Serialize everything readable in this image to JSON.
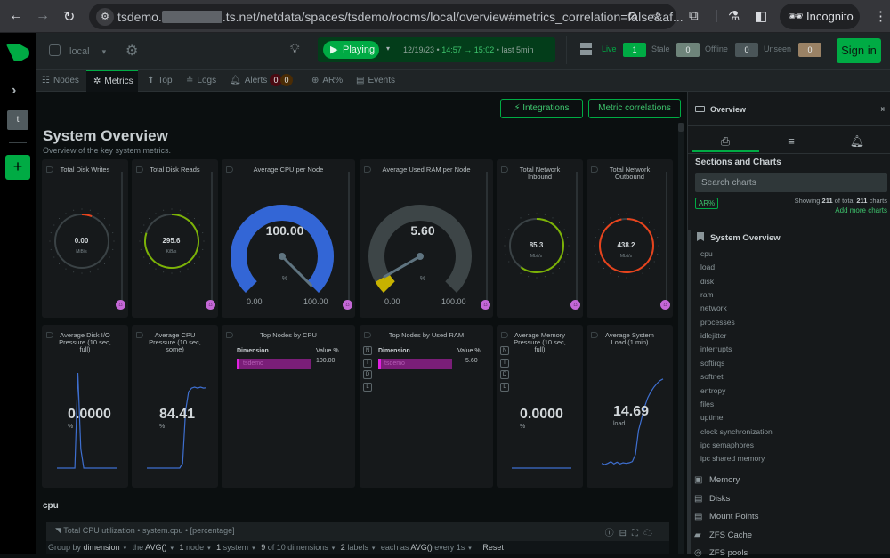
{
  "browser": {
    "url_prefix": "tsdemo.",
    "url_suffix": ".ts.net/netdata/spaces/tsdemo/rooms/local/overview#metrics_correlation=false&af...",
    "incognito_label": "Incognito",
    "icons": [
      "back-icon",
      "forward-icon",
      "reload-icon",
      "site-info-icon",
      "eye-off-icon",
      "star-icon",
      "extensions-icon",
      "labs-icon",
      "sidepanel-icon",
      "incognito-icon",
      "kebab-menu-icon"
    ]
  },
  "rail": {
    "space_initial": "t",
    "add_label": "+"
  },
  "topbar": {
    "room": "local",
    "play_label": "Playing",
    "date": "12/19/23",
    "time_from": "14:57",
    "arrow": "→",
    "time_to": "15:02",
    "last": "last  5min",
    "status": [
      {
        "label": "Live",
        "count": "1",
        "color": "#00ab44",
        "label_color": "#00ab44"
      },
      {
        "label": "Stale",
        "count": "0",
        "color": "#6e847a",
        "label_color": "#6c777b"
      },
      {
        "label": "Offline",
        "count": "0",
        "color": "#4a5558",
        "label_color": "#6c777b"
      },
      {
        "label": "Unseen",
        "count": "0",
        "color": "#9a8265",
        "label_color": "#6c777b"
      }
    ],
    "signin_label": "Sign in"
  },
  "tabs": [
    {
      "label": "Nodes",
      "icon": "☷"
    },
    {
      "label": "Metrics",
      "icon": "✲"
    },
    {
      "label": "Top",
      "icon": "⬆"
    },
    {
      "label": "Logs",
      "icon": "≗"
    },
    {
      "label": "Alerts",
      "icon": "🔔︎",
      "badges": [
        "0",
        "0"
      ]
    },
    {
      "label": "AR%",
      "icon": "⊕"
    },
    {
      "label": "Events",
      "icon": "▤"
    }
  ],
  "main": {
    "integrations_label": "Integrations",
    "metric_corr_label": "Metric correlations",
    "title": "System Overview",
    "subtitle": "Overview of the key system metrics.",
    "cards_row1": [
      {
        "title": "Total Disk Writes",
        "value": "0.00",
        "unit": "MiB/s",
        "fraction": 0.06,
        "color": "#e8431c",
        "start": 0.0
      },
      {
        "title": "Total Disk Reads",
        "value": "295.6",
        "unit": "KiB/s",
        "fraction": 0.8,
        "color": "#7cb305",
        "start": 0.0
      },
      {
        "title": "Average CPU per Node",
        "value": "100.00",
        "unit": "%",
        "min": "0.00",
        "max": "100.00",
        "fraction": 1.0,
        "color": "#3366d6"
      },
      {
        "title": "Average Used RAM per Node",
        "value": "5.60",
        "unit": "%",
        "min": "0.00",
        "max": "100.00",
        "fraction": 0.056,
        "color": "#c7b200"
      },
      {
        "title": "Total Network Inbound",
        "value": "85.3",
        "unit": "Mbit/s",
        "fraction": 0.6,
        "color": "#7cb305",
        "start": 0.0
      },
      {
        "title": "Total Network Outbound",
        "value": "438.2",
        "unit": "Mbit/s",
        "fraction": 0.97,
        "color": "#e8431c",
        "start": 0.0
      }
    ],
    "cards_row2": [
      {
        "title": "Average Disk I/O Pressure (10 sec, full)",
        "value": "0.0000",
        "unit": "%"
      },
      {
        "title": "Average CPU Pressure (10 sec, some)",
        "value": "84.41",
        "unit": "%"
      },
      {
        "title": "Top Nodes by CPU",
        "dim_header": "Dimension",
        "val_header": "Value %",
        "rows": [
          {
            "name": "tsdemo",
            "value": "100.00"
          }
        ]
      },
      {
        "title": "Top Nodes by Used RAM",
        "dim_header": "Dimension",
        "val_header": "Value %",
        "rows": [
          {
            "name": "tsdemo",
            "value": "5.60"
          }
        ],
        "ndil": [
          "N",
          "I",
          "D",
          "L"
        ]
      },
      {
        "title": "Average Memory Pressure (10 sec, full)",
        "value": "0.0000",
        "unit": "%",
        "ndil": [
          "N",
          "I",
          "D",
          "L"
        ]
      },
      {
        "title": "Average System Load (1 min)",
        "value": "14.69",
        "unit": "load"
      }
    ],
    "section": "cpu",
    "cpu_chart": {
      "title": "Total CPU utilization • system.cpu • [percentage]",
      "group_by": "Group by",
      "group_by_val": "dimension",
      "the": "the",
      "agg": "AVG()",
      "nodes_n": "1",
      "nodes": "node",
      "systems_n": "1",
      "systems": "system",
      "dims_n": "9",
      "dims": "of 10 dimensions",
      "labels_n": "2",
      "labels": "labels",
      "each_as": "each as",
      "each_agg": "AVG()",
      "every": "every 1s",
      "reset": "Reset"
    }
  },
  "chart_data": [
    {
      "type": "line",
      "title": "Average Disk I/O Pressure (10 sec, full)",
      "x": [
        0,
        1,
        2,
        3,
        4,
        5,
        6,
        7,
        8,
        9,
        10,
        11,
        12,
        13,
        14,
        15,
        16,
        17,
        18,
        19,
        20
      ],
      "values": [
        0,
        0,
        0,
        0,
        0,
        0,
        0,
        100,
        20,
        0,
        0,
        0,
        0,
        0,
        0,
        0,
        0,
        0,
        0,
        0,
        0
      ],
      "ylabel": "%"
    },
    {
      "type": "line",
      "title": "Average CPU Pressure (10 sec, some)",
      "x": [
        0,
        1,
        2,
        3,
        4,
        5,
        6,
        7,
        8,
        9,
        10,
        11,
        12,
        13,
        14,
        15,
        16,
        17,
        18,
        19,
        20
      ],
      "values": [
        0,
        0,
        0,
        0,
        0,
        0,
        0,
        0,
        0,
        0,
        0,
        0,
        5,
        60,
        80,
        84,
        85,
        84,
        85,
        84,
        84.41
      ],
      "ylabel": "%"
    },
    {
      "type": "line",
      "title": "Average Memory Pressure (10 sec, full)",
      "x": [
        0,
        1,
        2,
        3,
        4,
        5,
        6,
        7,
        8,
        9,
        10,
        11,
        12,
        13,
        14,
        15,
        16,
        17,
        18,
        19,
        20
      ],
      "values": [
        0,
        0,
        0,
        0,
        0,
        0,
        0,
        0,
        0,
        0,
        0,
        0,
        0,
        0,
        0,
        0,
        0,
        0,
        0,
        0,
        0
      ],
      "ylabel": "%"
    },
    {
      "type": "line",
      "title": "Average System Load (1 min)",
      "x": [
        0,
        1,
        2,
        3,
        4,
        5,
        6,
        7,
        8,
        9,
        10,
        11,
        12,
        13,
        14,
        15,
        16,
        17,
        18,
        19,
        20
      ],
      "values": [
        0.5,
        0.3,
        0.5,
        0.8,
        0.4,
        0.7,
        0.4,
        0.6,
        0.5,
        0.6,
        0.8,
        2,
        6,
        8,
        10,
        11.5,
        12.5,
        13.3,
        13.9,
        14.4,
        14.69
      ],
      "ylabel": "load"
    }
  ],
  "rpanel": {
    "title": "Overview",
    "sections_label": "Sections and Charts",
    "search_placeholder": "Search charts",
    "ar_label": "AR%",
    "showing_pre": "Showing",
    "showing_n": "211",
    "showing_mid": "of total",
    "showing_total": "211",
    "showing_post": "charts",
    "add_more": "Add more charts",
    "section": "System Overview",
    "items": [
      "cpu",
      "load",
      "disk",
      "ram",
      "network",
      "processes",
      "idlejitter",
      "interrupts",
      "softirqs",
      "softnet",
      "entropy",
      "files",
      "uptime",
      "clock synchronization",
      "ipc semaphores",
      "ipc shared memory"
    ],
    "groups": [
      {
        "label": "Memory",
        "icon": "▣"
      },
      {
        "label": "Disks",
        "icon": "▤"
      },
      {
        "label": "Mount Points",
        "icon": "▤"
      },
      {
        "label": "ZFS Cache",
        "icon": "▰"
      },
      {
        "label": "ZFS pools",
        "icon": "◎"
      }
    ]
  }
}
